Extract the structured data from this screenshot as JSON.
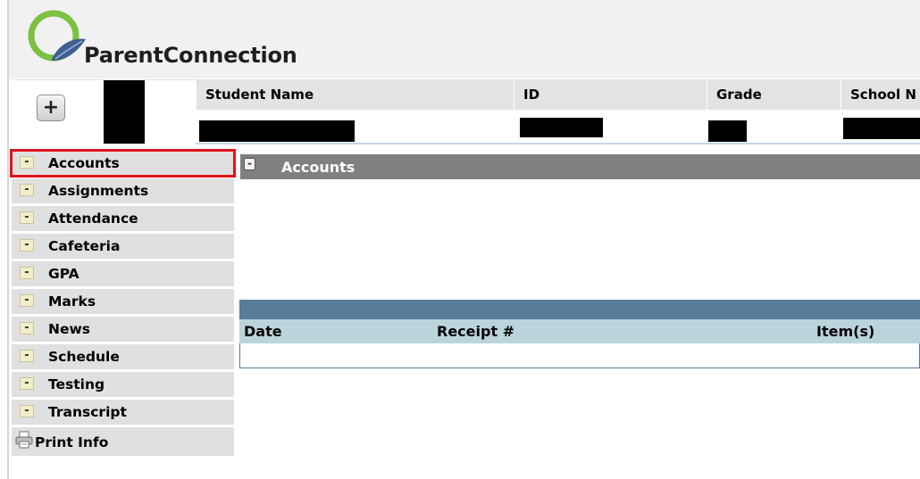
{
  "app": {
    "logo_text": "ParentConnection"
  },
  "student": {
    "add_label": "+",
    "columns": [
      {
        "label": "Student Name"
      },
      {
        "label": "ID"
      },
      {
        "label": "Grade"
      },
      {
        "label": "School N"
      }
    ]
  },
  "sidebar": {
    "toggle_glyph": "-",
    "items": [
      {
        "label": "Accounts",
        "selected": true
      },
      {
        "label": "Assignments"
      },
      {
        "label": "Attendance"
      },
      {
        "label": "Cafeteria"
      },
      {
        "label": "GPA"
      },
      {
        "label": "Marks"
      },
      {
        "label": "News"
      },
      {
        "label": "Schedule"
      },
      {
        "label": "Testing"
      },
      {
        "label": "Transcript"
      }
    ],
    "print_label": "Print Info"
  },
  "main": {
    "section_title": "Accounts",
    "section_toggle": "-",
    "table": {
      "headers": [
        "Date",
        "Receipt #",
        "Item(s)"
      ]
    }
  },
  "colors": {
    "selection_outline": "#e0141b",
    "section_bar": "#808080",
    "table_top": "#587c9a",
    "table_head": "#b9d5db",
    "logo_green": "#7cc142",
    "logo_blue": "#3f5f8f"
  }
}
